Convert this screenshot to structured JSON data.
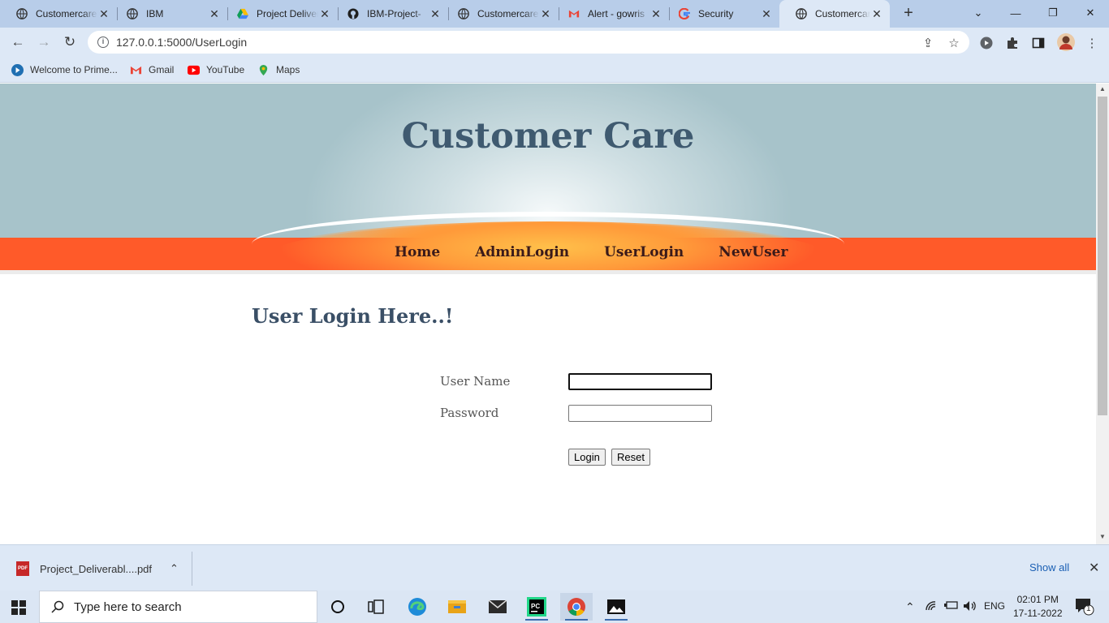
{
  "browser": {
    "tabs": [
      {
        "label": "Customercare",
        "icon": "globe-icon"
      },
      {
        "label": "IBM",
        "icon": "globe-icon"
      },
      {
        "label": "Project Deliverables",
        "icon": "drive-icon"
      },
      {
        "label": "IBM-Project-",
        "icon": "github-icon"
      },
      {
        "label": "Customercare",
        "icon": "globe-icon"
      },
      {
        "label": "Alert - gowris",
        "icon": "gmail-icon"
      },
      {
        "label": "Security",
        "icon": "google-icon"
      },
      {
        "label": "Customercare",
        "icon": "globe-icon",
        "active": true
      }
    ],
    "url": "127.0.0.1:5000/UserLogin",
    "bookmarks": [
      {
        "label": "Welcome to Prime...",
        "icon": "prime-icon"
      },
      {
        "label": "Gmail",
        "icon": "gmail-icon"
      },
      {
        "label": "YouTube",
        "icon": "youtube-icon"
      },
      {
        "label": "Maps",
        "icon": "maps-icon"
      }
    ]
  },
  "site": {
    "title": "Customer Care",
    "nav": [
      "Home",
      "AdminLogin",
      "UserLogin",
      "NewUser"
    ],
    "heading": "User Login Here..!",
    "form": {
      "username_label": "User Name",
      "username_value": "",
      "password_label": "Password",
      "password_value": "",
      "login_label": "Login",
      "reset_label": "Reset"
    }
  },
  "downloads": {
    "file": "Project_Deliverabl....pdf",
    "show_all": "Show all"
  },
  "taskbar": {
    "search_placeholder": "Type here to search",
    "lang": "ENG",
    "time": "02:01 PM",
    "date": "17-11-2022",
    "notifications": "1"
  },
  "colors": {
    "menu_bar": "#ff5a29",
    "header_bg": "#a7c3ca",
    "title_text": "#3f5a70",
    "nav_text": "#3a1a1a"
  }
}
